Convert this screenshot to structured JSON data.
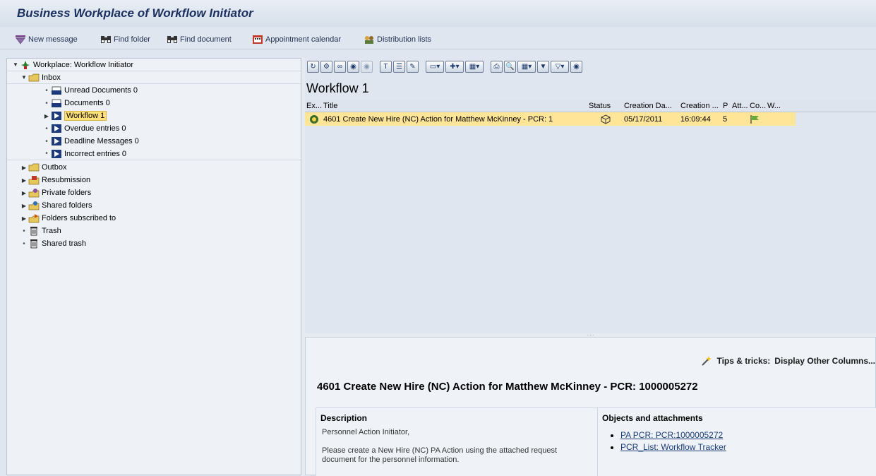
{
  "title": "Business Workplace of Workflow Initiator",
  "appbar": {
    "new_message": "New message",
    "find_folder": "Find folder",
    "find_document": "Find document",
    "appointment_calendar": "Appointment calendar",
    "distribution_lists": "Distribution lists"
  },
  "tree": {
    "root": "Workplace: Workflow Initiator",
    "inbox": "Inbox",
    "unread": "Unread Documents 0",
    "documents": "Documents 0",
    "workflow": "Workflow 1",
    "overdue": "Overdue entries 0",
    "deadline": "Deadline Messages 0",
    "incorrect": "Incorrect entries 0",
    "outbox": "Outbox",
    "resubmission": "Resubmission",
    "private": "Private folders",
    "shared": "Shared folders",
    "subscribed": "Folders subscribed to",
    "trash": "Trash",
    "shared_trash": "Shared trash"
  },
  "list": {
    "title": "Workflow 1",
    "headers": {
      "ex": "Ex...",
      "title": "Title",
      "status": "Status",
      "creation_date": "Creation Da...",
      "creation_time": "Creation ...",
      "p": "P",
      "att": "Att...",
      "co": "Co...",
      "w": "W..."
    },
    "row": {
      "title": "4601 Create New Hire (NC) Action for Matthew McKinney - PCR: 1",
      "creation_date": "05/17/2011",
      "creation_time": "16:09:44",
      "p": "5"
    }
  },
  "detail": {
    "tips_label": "Tips & tricks:",
    "tips_link": "Display Other Columns...",
    "heading": "4601 Create New Hire (NC) Action for Matthew McKinney - PCR: 1000005272",
    "description_title": "Description",
    "description_line1": "Personnel Action Initiator,",
    "description_line2": "Please create a New Hire (NC) PA Action using the attached request document for the personnel information.",
    "objects_title": "Objects and attachments",
    "attachment1": "PA PCR: PCR:1000005272",
    "attachment2": "PCR_List: Workflow Tracker"
  }
}
